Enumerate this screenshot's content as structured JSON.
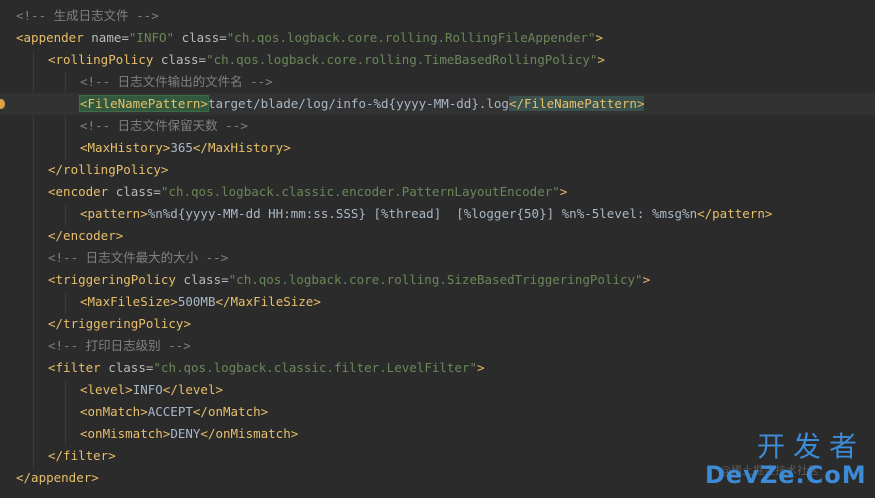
{
  "colors": {
    "background": "#2b2b2b",
    "tag": "#e8bf6a",
    "attribute": "#bababa",
    "string": "#6a8759",
    "comment": "#808080",
    "text": "#a9b7c6",
    "watermark": "#3d8bd6"
  },
  "code": {
    "comment1": "<!-- 生成日志文件 -->",
    "appender_open": "<appender",
    "attr_name": "name",
    "val_name": "\"INFO\"",
    "attr_class": "class",
    "val_appender_class": "\"ch.qos.logback.core.rolling.RollingFileAppender\"",
    "rolling_open": "<rollingPolicy",
    "val_rolling_class": "\"ch.qos.logback.core.rolling.TimeBasedRollingPolicy\"",
    "comment2": "<!-- 日志文件输出的文件名 -->",
    "fnp_open": "<FileNamePattern>",
    "fnp_value": "target/blade/log/info-%d{yyyy-MM-dd}.log",
    "fnp_close": "</FileNamePattern>",
    "comment3": "<!-- 日志文件保留天数 -->",
    "mh_open": "<MaxHistory>",
    "mh_value": "365",
    "mh_close": "</MaxHistory>",
    "rolling_close": "</rollingPolicy>",
    "encoder_open": "<encoder",
    "val_encoder_class": "\"ch.qos.logback.classic.encoder.PatternLayoutEncoder\"",
    "pattern_open": "<pattern>",
    "pattern_value": "%n%d{yyyy-MM-dd HH:mm:ss.SSS} [%thread]  [%logger{50}] %n%-5level: %msg%n",
    "pattern_close": "</pattern>",
    "encoder_close": "</encoder>",
    "comment4": "<!-- 日志文件最大的大小 -->",
    "trig_open": "<triggeringPolicy",
    "val_trig_class": "\"ch.qos.logback.core.rolling.SizeBasedTriggeringPolicy\"",
    "mfs_open": "<MaxFileSize>",
    "mfs_value": "500MB",
    "mfs_close": "</MaxFileSize>",
    "trig_close": "</triggeringPolicy>",
    "comment5": "<!-- 打印日志级别 -->",
    "filter_open": "<filter",
    "val_filter_class": "\"ch.qos.logback.classic.filter.LevelFilter\"",
    "level_open": "<level>",
    "level_value": "INFO",
    "level_close": "</level>",
    "onmatch_open": "<onMatch>",
    "onmatch_value": "ACCEPT",
    "onmatch_close": "</onMatch>",
    "onmismatch_open": "<onMismatch>",
    "onmismatch_value": "DENY",
    "onmismatch_close": "</onMismatch>",
    "filter_close": "</filter>",
    "appender_close": "</appender>",
    "gt": ">"
  },
  "watermark": {
    "top": "开发者",
    "bottom": "DevZe.CoM",
    "faint": "@稀土掘金技术社区"
  }
}
